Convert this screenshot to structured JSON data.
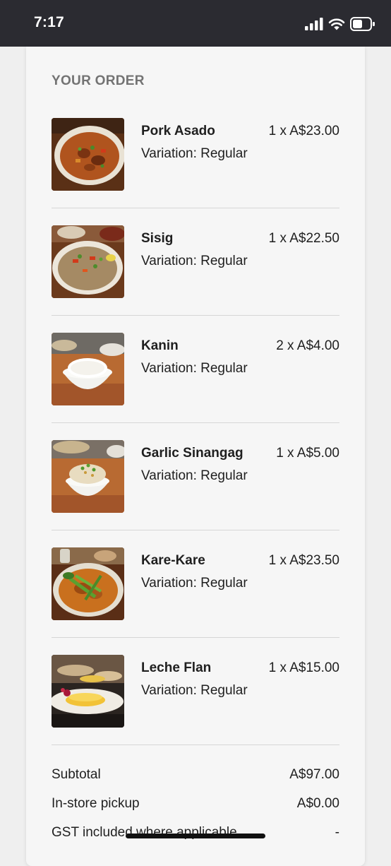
{
  "status_bar": {
    "time": "7:17",
    "icons": [
      "cellular-signal-icon",
      "wifi-icon",
      "battery-icon"
    ]
  },
  "order": {
    "title": "YOUR ORDER",
    "variation_prefix": "Variation:",
    "items": [
      {
        "name": "Pork Asado",
        "quantity": "1 x A$23.00",
        "variation": "Variation: Regular",
        "thumbnail": "pork-asado-photo"
      },
      {
        "name": "Sisig",
        "quantity": "1 x A$22.50",
        "variation": "Variation: Regular",
        "thumbnail": "sisig-photo"
      },
      {
        "name": "Kanin",
        "quantity": "2 x A$4.00",
        "variation": "Variation: Regular",
        "thumbnail": "kanin-photo"
      },
      {
        "name": "Garlic Sinangag",
        "quantity": "1 x A$5.00",
        "variation": "Variation: Regular",
        "thumbnail": "garlic-sinangag-photo"
      },
      {
        "name": "Kare-Kare",
        "quantity": "1 x A$23.50",
        "variation": "Variation: Regular",
        "thumbnail": "kare-kare-photo"
      },
      {
        "name": "Leche Flan",
        "quantity": "1 x A$15.00",
        "variation": "Variation: Regular",
        "thumbnail": "leche-flan-photo"
      }
    ]
  },
  "summary": {
    "rows": [
      {
        "label": "Subtotal",
        "value": "A$97.00"
      },
      {
        "label": "In-store pickup",
        "value": "A$0.00"
      },
      {
        "label": "GST included where applicable",
        "value": "-"
      }
    ]
  },
  "colors": {
    "status_bar_bg": "#2b2b31",
    "page_bg": "#efefef",
    "card_bg": "#f6f6f6",
    "section_title": "#737373",
    "text": "#1f1f1f",
    "divider": "#d6d6d6"
  }
}
